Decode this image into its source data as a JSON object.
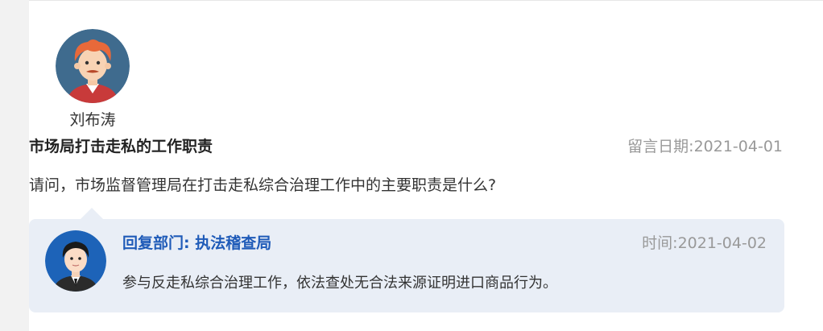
{
  "user": {
    "name": "刘布涛",
    "avatar_icon": "cartoon-man-avatar"
  },
  "message": {
    "title": "市场局打击走私的工作职责",
    "date_label": "留言日期:",
    "date": "2021-04-01",
    "body": "请问，市场监督管理局在打击走私综合治理工作中的主要职责是什么?"
  },
  "reply": {
    "avatar_icon": "official-avatar",
    "dept_label": "回复部门:",
    "dept": "执法稽查局",
    "time_label": "时间:",
    "time": "2021-04-02",
    "body": "参与反走私综合治理工作，依法查处无合法来源证明进口商品行为。"
  },
  "colors": {
    "reply_bg": "#e9eef6",
    "dept_blue": "#1f5bb8",
    "muted": "#999999"
  }
}
